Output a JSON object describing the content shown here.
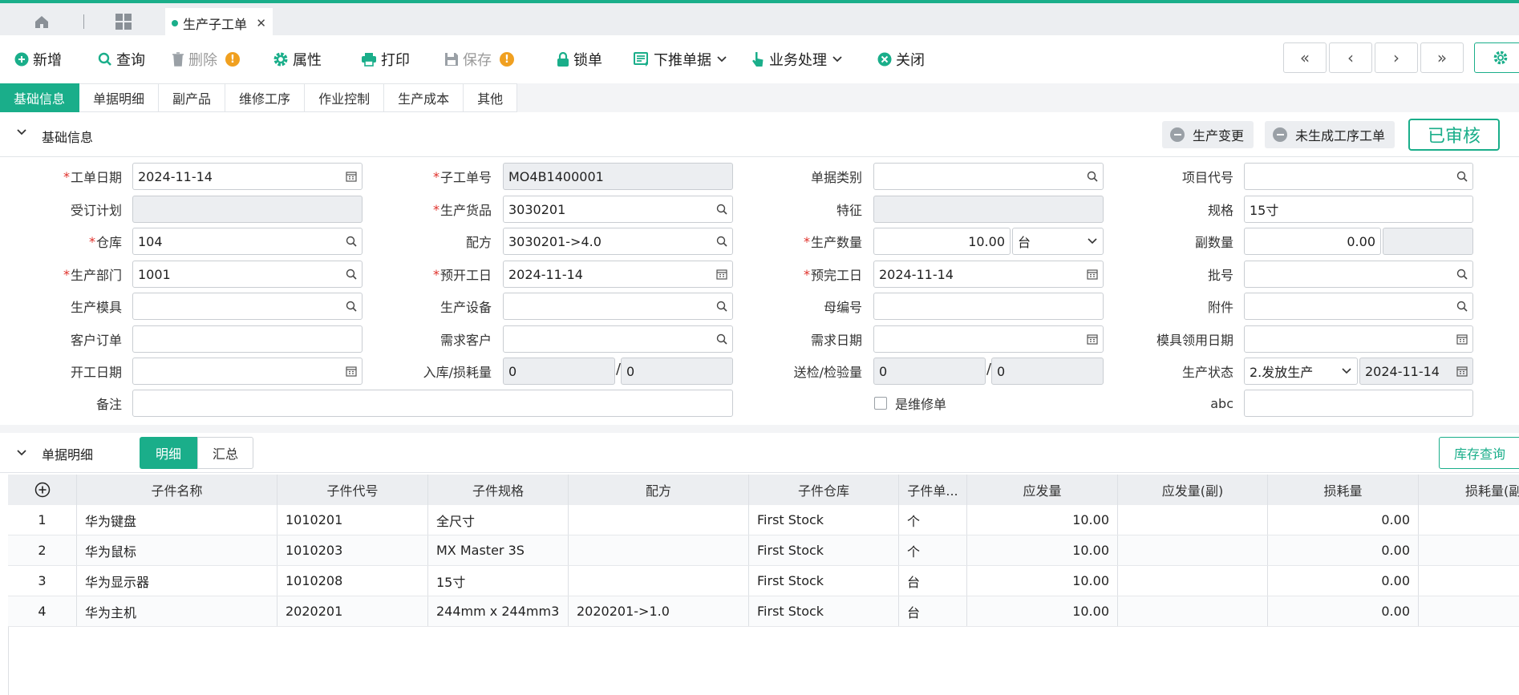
{
  "tabbar": {
    "page_tab": "生产子工单",
    "close": "✕"
  },
  "toolbar": {
    "add": "新增",
    "query": "查询",
    "delete": "删除",
    "attributes": "属性",
    "print": "打印",
    "save": "保存",
    "lock": "锁单",
    "push_down": "下推单据",
    "business": "业务处理",
    "close": "关闭",
    "warning_mark": "!"
  },
  "nav": {
    "first": "«",
    "prev": "‹",
    "next": "›",
    "last": "»"
  },
  "section_tabs": [
    "基础信息",
    "单据明细",
    "副产品",
    "维修工序",
    "作业控制",
    "生产成本",
    "其他"
  ],
  "basic_info": {
    "title": "基础信息",
    "btn_change": "生产变更",
    "btn_no_process": "未生成工序工单",
    "status_stamp": "已审核",
    "labels": {
      "order_date": "工单日期",
      "sub_order_no": "子工单号",
      "doc_type": "单据类别",
      "project_code": "项目代号",
      "order_plan": "受订计划",
      "product": "生产货品",
      "feature": "特征",
      "spec": "规格",
      "warehouse": "仓库",
      "formula": "配方",
      "qty": "生产数量",
      "sub_qty": "副数量",
      "dept": "生产部门",
      "planned_start": "预开工日",
      "planned_finish": "预完工日",
      "batch": "批号",
      "mold": "生产模具",
      "equipment": "生产设备",
      "parent_no": "母编号",
      "attachment": "附件",
      "customer_order": "客户订单",
      "demand_customer": "需求客户",
      "demand_date": "需求日期",
      "mold_date": "模具领用日期",
      "start_date": "开工日期",
      "inbound_loss": "入库/损耗量",
      "inspect_qty": "送检/检验量",
      "prod_status": "生产状态",
      "remark": "备注",
      "is_repair": "是维修单",
      "abc": "abc"
    },
    "values": {
      "order_date": "2024-11-14",
      "sub_order_no": "MO4B1400001",
      "doc_type": "",
      "project_code": "",
      "order_plan": "",
      "product": "3030201",
      "feature": "",
      "spec": "15寸",
      "warehouse": "104",
      "formula": "3030201->4.0",
      "qty": "10.00",
      "qty_unit": "台",
      "sub_qty": "0.00",
      "sub_qty_unit": "",
      "dept": "1001",
      "planned_start": "2024-11-14",
      "planned_finish": "2024-11-14",
      "batch": "",
      "mold": "",
      "equipment": "",
      "parent_no": "",
      "attachment": "",
      "customer_order": "",
      "demand_customer": "",
      "demand_date": "",
      "mold_date": "",
      "start_date": "",
      "inbound": "0",
      "loss": "0",
      "inspect_send": "0",
      "inspect_done": "0",
      "prod_status": "2.发放生产",
      "status_date": "2024-11-14",
      "remark": "",
      "abc": "",
      "slash": "/"
    }
  },
  "detail": {
    "title": "单据明细",
    "seg_detail": "明细",
    "seg_summary": "汇总",
    "stock_query": "库存查询",
    "add_row": "⊕",
    "columns": [
      "",
      "子件名称",
      "子件代号",
      "子件规格",
      "配方",
      "子件仓库",
      "子件单...",
      "应发量",
      "应发量(副)",
      "损耗量",
      "损耗量(副"
    ],
    "rows": [
      {
        "no": "1",
        "name": "华为键盘",
        "code": "1010201",
        "spec": "全尺寸",
        "formula": "",
        "warehouse": "First Stock",
        "unit": "个",
        "qty": "10.00",
        "qty_sub": "",
        "loss": "0.00",
        "loss_sub": ""
      },
      {
        "no": "2",
        "name": "华为鼠标",
        "code": "1010203",
        "spec": "MX Master 3S",
        "formula": "",
        "warehouse": "First Stock",
        "unit": "个",
        "qty": "10.00",
        "qty_sub": "",
        "loss": "0.00",
        "loss_sub": ""
      },
      {
        "no": "3",
        "name": "华为显示器",
        "code": "1010208",
        "spec": "15寸",
        "formula": "",
        "warehouse": "First Stock",
        "unit": "台",
        "qty": "10.00",
        "qty_sub": "",
        "loss": "0.00",
        "loss_sub": ""
      },
      {
        "no": "4",
        "name": "华为主机",
        "code": "2020201",
        "spec": "244mm x 244mm3",
        "formula": "2020201->1.0",
        "warehouse": "First Stock",
        "unit": "台",
        "qty": "10.00",
        "qty_sub": "",
        "loss": "0.00",
        "loss_sub": ""
      }
    ]
  },
  "colors": {
    "accent": "#1aae8a",
    "required": "#e0302a",
    "warning": "#f0a020"
  }
}
